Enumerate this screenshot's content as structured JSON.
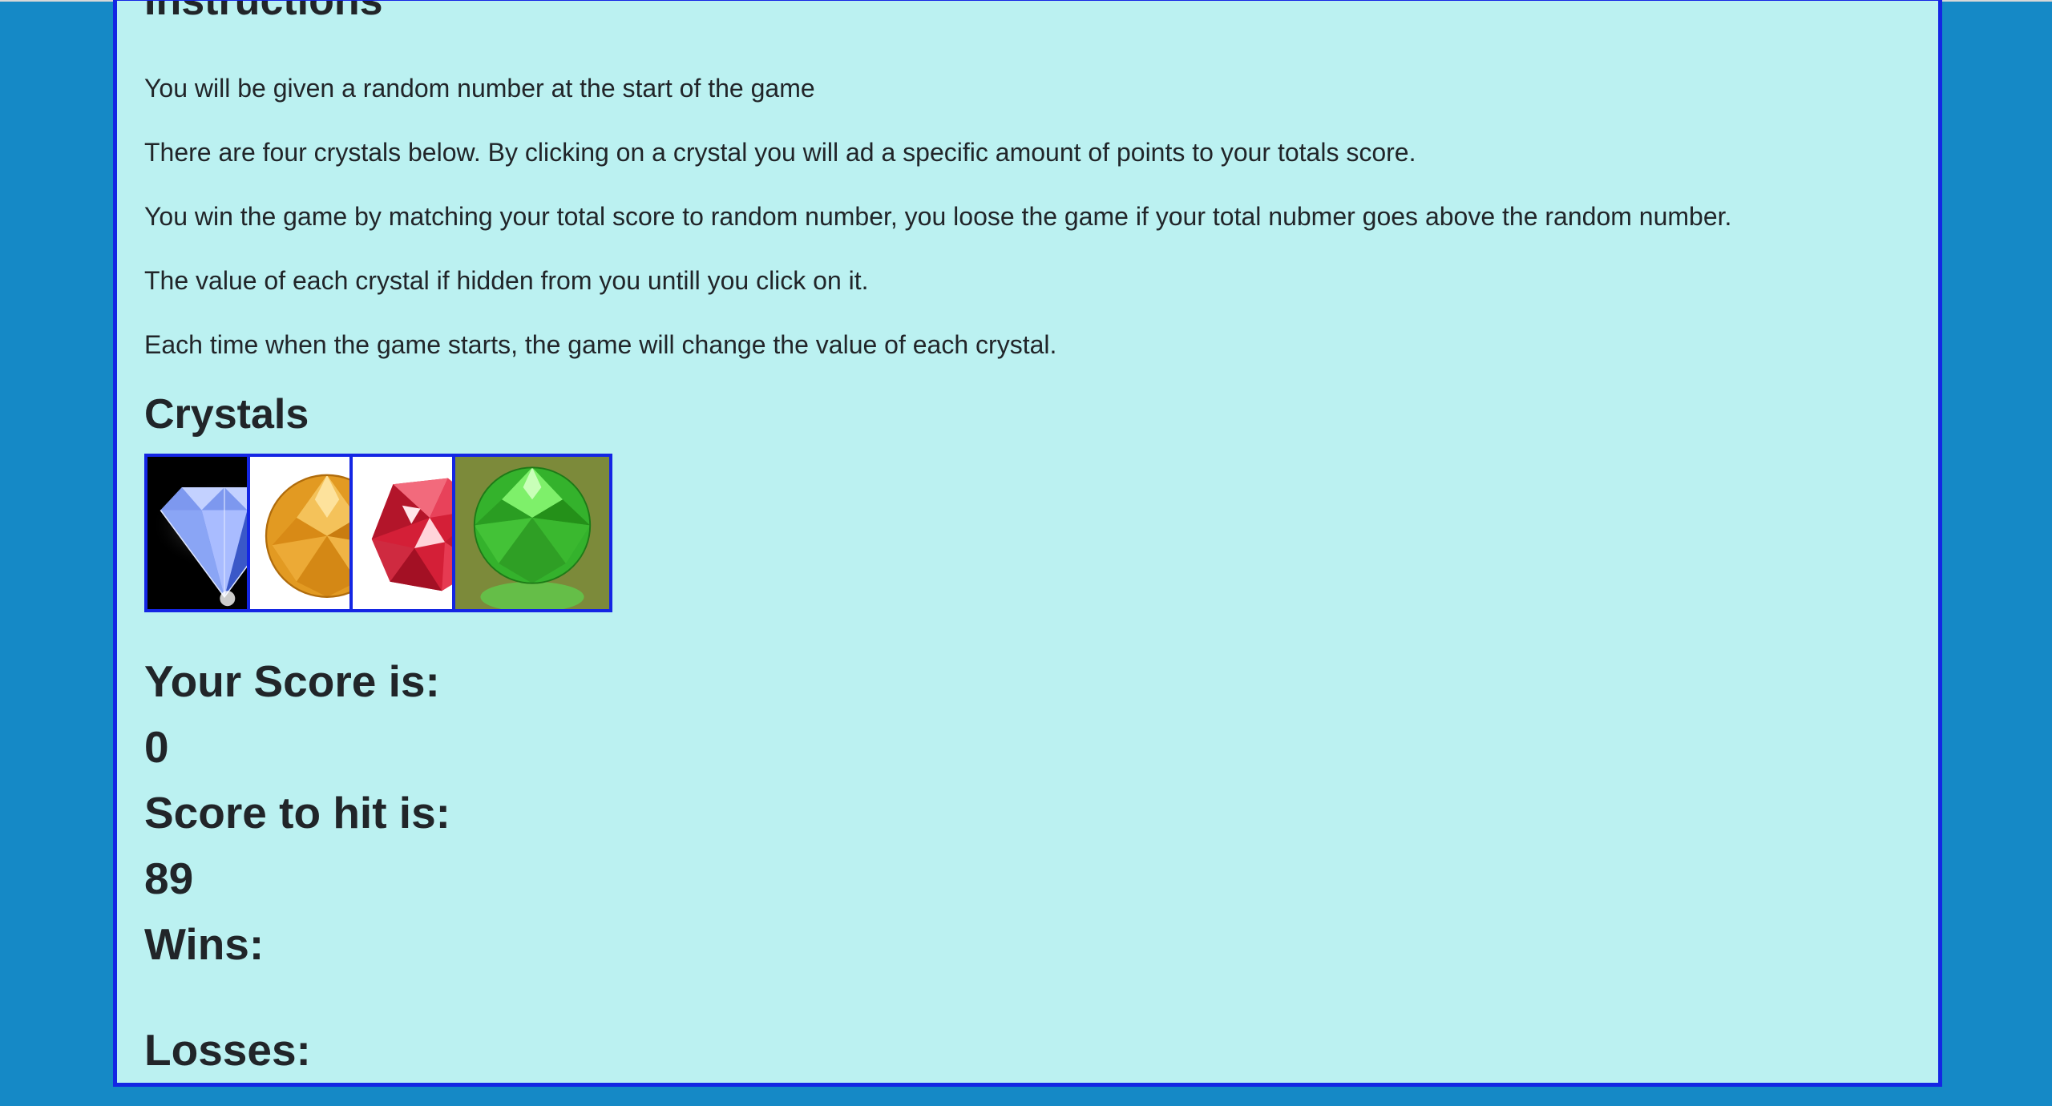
{
  "instructions_heading": "Instructions",
  "instructions": [
    "You will be given a random number at the start of the game",
    "There are four crystals below. By clicking on a crystal you will ad a specific amount of points to your totals score.",
    "You win the game by matching your total score to random number, you loose the game if your total nubmer goes above the random number.",
    "The value of each crystal if hidden from you untill you click on it.",
    "Each time when the game starts, the game will change the value of each crystal."
  ],
  "crystals_heading": "Crystals",
  "crystals": [
    {
      "icon": "blue-diamond-icon",
      "color": "#5a7fe8",
      "background": "#000000"
    },
    {
      "icon": "orange-crystal-icon",
      "color": "#e5a02a",
      "background": "#ffffff"
    },
    {
      "icon": "red-crystal-icon",
      "color": "#d8243a",
      "background": "#ffffff"
    },
    {
      "icon": "green-crystal-icon",
      "color": "#3fc23a",
      "background": "#7c8a3a"
    }
  ],
  "score_label": "Your Score is:",
  "score_value": "0",
  "target_label": "Score to hit is:",
  "target_value": "89",
  "wins_label": "Wins:",
  "wins_value": "",
  "losses_label": "Losses:",
  "losses_value": "",
  "colors": {
    "page_background": "#1589c6",
    "panel_background": "#bbf1f1",
    "border": "#1426e4"
  }
}
